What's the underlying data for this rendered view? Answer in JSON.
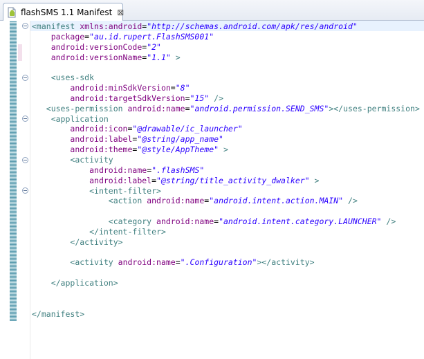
{
  "tab": {
    "title": "flashSMS 1.1 Manifest",
    "close_glyph": "⊠",
    "icon": "android-manifest-file-icon"
  },
  "colors": {
    "tag": "#3f7f7f",
    "attribute": "#7f007f",
    "value": "#2a00ff",
    "current_line": "#e8f2fe"
  },
  "code_lines": [
    {
      "indent": 0,
      "tokens": [
        [
          "tag",
          "<manifest"
        ],
        [
          "sp",
          " "
        ],
        [
          "attr",
          "xmlns:android"
        ],
        [
          "eq",
          "="
        ],
        [
          "val",
          "\"http://schemas.android.com/apk/res/android\""
        ]
      ]
    },
    {
      "indent": 4,
      "tokens": [
        [
          "attr",
          "package"
        ],
        [
          "eq",
          "="
        ],
        [
          "val",
          "\"au.id.rupert.FlashSMS001\""
        ]
      ]
    },
    {
      "indent": 4,
      "tokens": [
        [
          "attr",
          "android:versionCode"
        ],
        [
          "eq",
          "="
        ],
        [
          "val",
          "\"2\""
        ]
      ]
    },
    {
      "indent": 4,
      "tokens": [
        [
          "attr",
          "android:versionName"
        ],
        [
          "eq",
          "="
        ],
        [
          "val",
          "\"1.1\""
        ],
        [
          "sp",
          " "
        ],
        [
          "tag",
          ">"
        ]
      ]
    },
    {
      "indent": 0,
      "tokens": []
    },
    {
      "indent": 4,
      "tokens": [
        [
          "tag",
          "<uses-sdk"
        ]
      ]
    },
    {
      "indent": 8,
      "tokens": [
        [
          "attr",
          "android:minSdkVersion"
        ],
        [
          "eq",
          "="
        ],
        [
          "val",
          "\"8\""
        ]
      ]
    },
    {
      "indent": 8,
      "tokens": [
        [
          "attr",
          "android:targetSdkVersion"
        ],
        [
          "eq",
          "="
        ],
        [
          "val",
          "\"15\""
        ],
        [
          "sp",
          " "
        ],
        [
          "tag",
          "/>"
        ]
      ]
    },
    {
      "indent": 3,
      "tokens": [
        [
          "tag",
          "<uses-permission"
        ],
        [
          "sp",
          " "
        ],
        [
          "attr",
          "android:name"
        ],
        [
          "eq",
          "="
        ],
        [
          "val",
          "\"android.permission.SEND_SMS\""
        ],
        [
          "tag",
          "></uses-permission>"
        ]
      ]
    },
    {
      "indent": 4,
      "tokens": [
        [
          "tag",
          "<application"
        ]
      ]
    },
    {
      "indent": 8,
      "tokens": [
        [
          "attr",
          "android:icon"
        ],
        [
          "eq",
          "="
        ],
        [
          "val",
          "\"@drawable/ic_launcher\""
        ]
      ]
    },
    {
      "indent": 8,
      "tokens": [
        [
          "attr",
          "android:label"
        ],
        [
          "eq",
          "="
        ],
        [
          "val",
          "\"@string/app_name\""
        ]
      ]
    },
    {
      "indent": 8,
      "tokens": [
        [
          "attr",
          "android:theme"
        ],
        [
          "eq",
          "="
        ],
        [
          "val",
          "\"@style/AppTheme\""
        ],
        [
          "sp",
          " "
        ],
        [
          "tag",
          ">"
        ]
      ]
    },
    {
      "indent": 8,
      "tokens": [
        [
          "tag",
          "<activity"
        ]
      ]
    },
    {
      "indent": 12,
      "tokens": [
        [
          "attr",
          "android:name"
        ],
        [
          "eq",
          "="
        ],
        [
          "val",
          "\".flashSMS\""
        ]
      ]
    },
    {
      "indent": 12,
      "tokens": [
        [
          "attr",
          "android:label"
        ],
        [
          "eq",
          "="
        ],
        [
          "val",
          "\"@string/title_activity_dwalker\""
        ],
        [
          "sp",
          " "
        ],
        [
          "tag",
          ">"
        ]
      ]
    },
    {
      "indent": 12,
      "tokens": [
        [
          "tag",
          "<intent-filter>"
        ]
      ]
    },
    {
      "indent": 16,
      "tokens": [
        [
          "tag",
          "<action"
        ],
        [
          "sp",
          " "
        ],
        [
          "attr",
          "android:name"
        ],
        [
          "eq",
          "="
        ],
        [
          "val",
          "\"android.intent.action.MAIN\""
        ],
        [
          "sp",
          " "
        ],
        [
          "tag",
          "/>"
        ]
      ]
    },
    {
      "indent": 0,
      "tokens": []
    },
    {
      "indent": 16,
      "tokens": [
        [
          "tag",
          "<category"
        ],
        [
          "sp",
          " "
        ],
        [
          "attr",
          "android:name"
        ],
        [
          "eq",
          "="
        ],
        [
          "val",
          "\"android.intent.category.LAUNCHER\""
        ],
        [
          "sp",
          " "
        ],
        [
          "tag",
          "/>"
        ]
      ]
    },
    {
      "indent": 12,
      "tokens": [
        [
          "tag",
          "</intent-filter>"
        ]
      ]
    },
    {
      "indent": 8,
      "tokens": [
        [
          "tag",
          "</activity>"
        ]
      ]
    },
    {
      "indent": 0,
      "tokens": []
    },
    {
      "indent": 8,
      "tokens": [
        [
          "tag",
          "<activity"
        ],
        [
          "sp",
          " "
        ],
        [
          "attr",
          "android:name"
        ],
        [
          "eq",
          "="
        ],
        [
          "val",
          "\".Configuration\""
        ],
        [
          "tag",
          "></activity>"
        ]
      ]
    },
    {
      "indent": 0,
      "tokens": []
    },
    {
      "indent": 4,
      "tokens": [
        [
          "tag",
          "</application>"
        ]
      ]
    },
    {
      "indent": 0,
      "tokens": []
    },
    {
      "indent": 0,
      "tokens": []
    },
    {
      "indent": 0,
      "tokens": [
        [
          "tag",
          "</manifest>"
        ]
      ]
    }
  ]
}
